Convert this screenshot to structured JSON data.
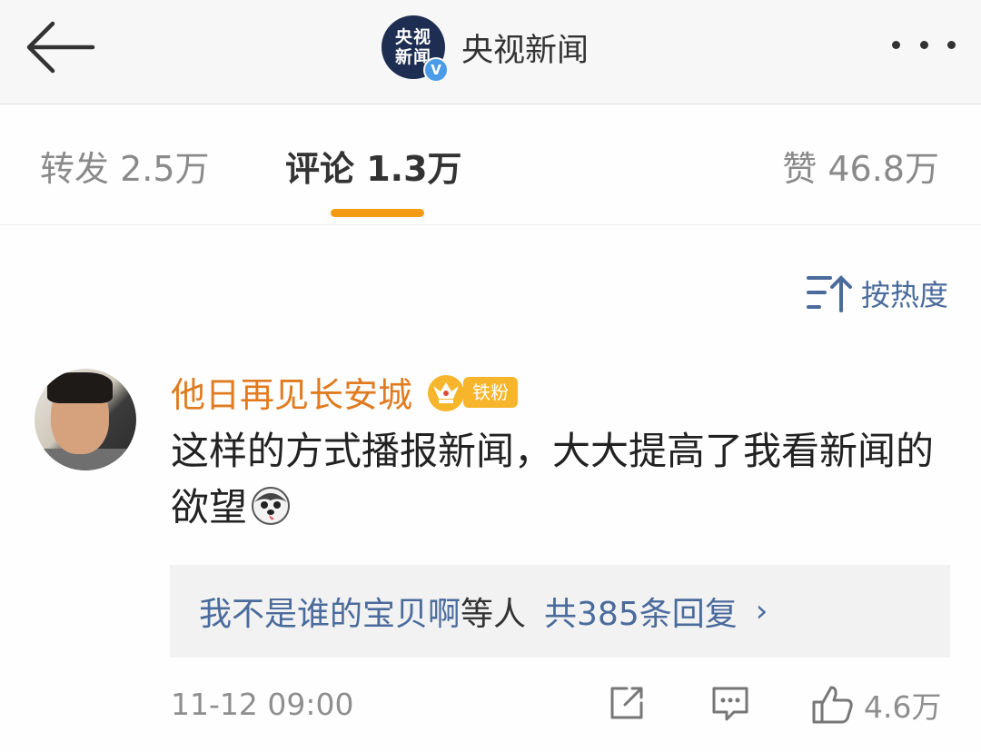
{
  "header": {
    "account_name": "央视新闻",
    "logo_line1": "央视",
    "logo_line2": "新闻",
    "verified_mark": "V",
    "icons": {
      "back": "back-arrow-icon",
      "more": "more-dots-icon"
    }
  },
  "tabs": {
    "repost_label": "转发 2.5万",
    "comments_label": "评论 1.3万",
    "likes_label": "赞 46.8万",
    "active": "comments",
    "accent_color": "#f39c12"
  },
  "sort": {
    "label": "按热度",
    "icon": "sort-icon"
  },
  "comment": {
    "username": "他日再见长安城",
    "badge_label": "铁粉",
    "text": "这样的方式播报新闻，大大提高了我看新闻的欲望",
    "emoji": "husky-emoji-icon",
    "replies": {
      "who": "我不是谁的宝贝啊",
      "etc": "等人",
      "count": "共385条回复",
      "chevron": "›"
    },
    "timestamp": "11-12 09:00",
    "like_count": "4.6万",
    "icons": {
      "share": "share-icon",
      "comment": "comment-icon",
      "like": "thumbs-up-icon"
    }
  },
  "colors": {
    "username": "#e07b1f",
    "link_blue": "#4a6b9c",
    "badge_gold": "#f6b52a"
  }
}
